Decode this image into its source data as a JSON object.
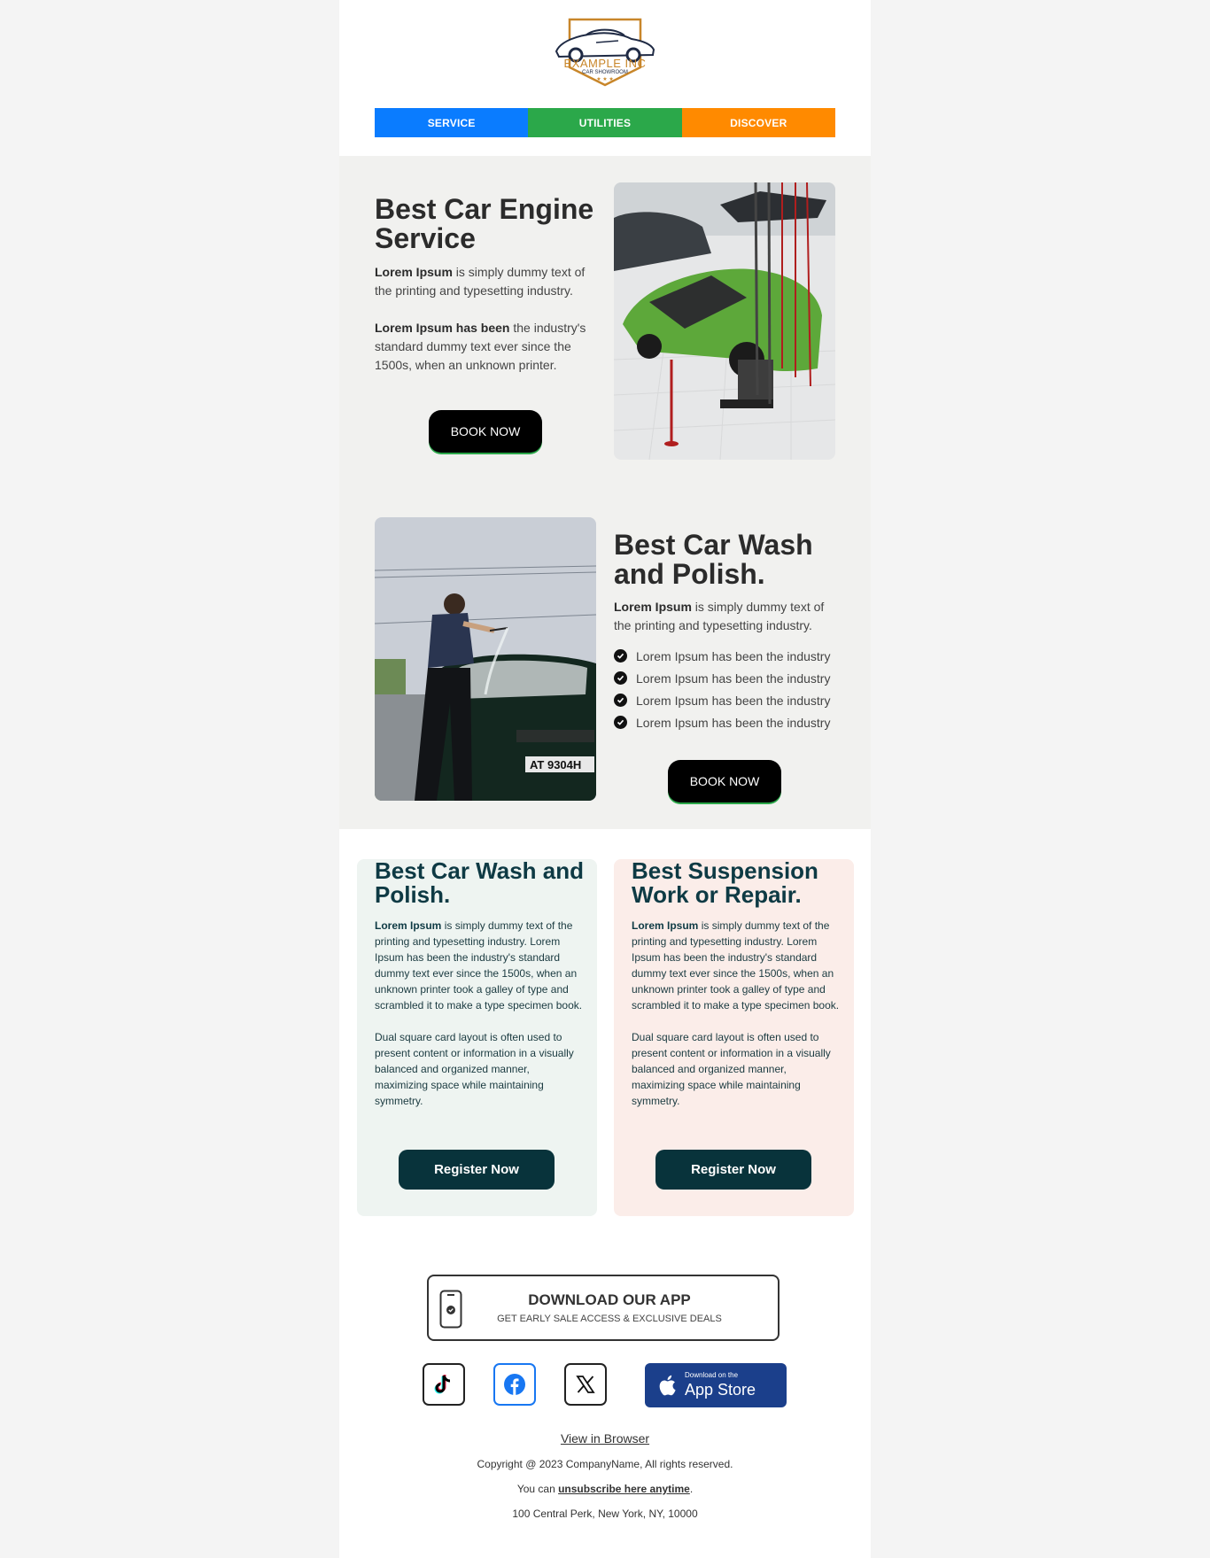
{
  "brand": {
    "name": "EXAMPLE INC",
    "tagline": "CAR SHOWROOM",
    "stars": "★ ★ ★",
    "colors": {
      "gold": "#c8862a",
      "navy": "#1f2a44"
    }
  },
  "nav": {
    "items": [
      {
        "label": "SERVICE",
        "color": "#0a7cff"
      },
      {
        "label": "UTILITIES",
        "color": "#2ba84a"
      },
      {
        "label": "DISCOVER",
        "color": "#ff8a00"
      }
    ]
  },
  "section1": {
    "title": "Best Car Engine Service",
    "p1_bold": "Lorem Ipsum",
    "p1_rest": " is simply dummy text of the printing and typesetting industry.",
    "p2_bold": "Lorem Ipsum has been",
    "p2_rest": " the industry's standard dummy text ever since the 1500s, when an unknown printer.",
    "button": "BOOK NOW"
  },
  "section2": {
    "title": "Best Car Wash and Polish.",
    "p1_bold": "Lorem Ipsum",
    "p1_rest": " is simply dummy text of the printing and typesetting industry.",
    "bullets": [
      "Lorem Ipsum has been the industry",
      "Lorem Ipsum has been the industry",
      "Lorem Ipsum has been the industry",
      "Lorem Ipsum has been the industry"
    ],
    "plate": "AT 9304H",
    "button": "BOOK NOW"
  },
  "cards": [
    {
      "title": "Best Car Wash and Polish.",
      "p1_bold": "Lorem Ipsum",
      "p1_rest": " is simply dummy text of the printing and typesetting industry. Lorem Ipsum has been the industry's standard dummy text ever since the 1500s, when an unknown printer took a galley of type and scrambled it to make a type specimen book.",
      "p2": "Dual square card layout is often used to present content or information in a visually balanced and organized manner, maximizing space while maintaining symmetry.",
      "button": "Register Now"
    },
    {
      "title": "Best Suspension Work or Repair.",
      "p1_bold": "Lorem Ipsum",
      "p1_rest": " is simply dummy text of the printing and typesetting industry. Lorem Ipsum has been the industry's standard dummy text ever since the 1500s, when an unknown printer took a galley of type and scrambled it to make a type specimen book.",
      "p2": "Dual square card layout is often used to present content or information in a visually balanced and organized manner, maximizing space while maintaining symmetry.",
      "button": "Register Now"
    }
  ],
  "app": {
    "title": "DOWNLOAD OUR APP",
    "subtitle": "GET EARLY SALE ACCESS & EXCLUSIVE DEALS"
  },
  "social": {
    "icons": [
      "tiktok-icon",
      "facebook-icon",
      "x-icon"
    ],
    "appstore_small": "Download on the",
    "appstore_big": "App Store"
  },
  "footer": {
    "view_browser": "View in Browser",
    "copyright": "Copyright @ 2023 CompanyName, All rights reserved.",
    "unsub_prefix": "You can ",
    "unsub_link": "unsubscribe here anytime",
    "unsub_suffix": ".",
    "address": "100 Central Perk, New York, NY, 10000"
  }
}
